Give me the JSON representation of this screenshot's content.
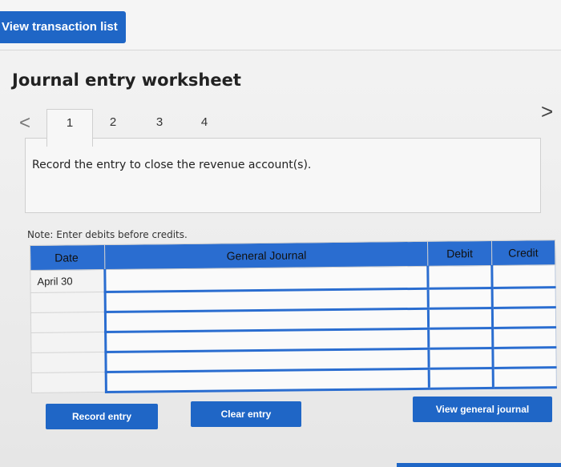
{
  "top": {
    "view_transaction_list": "View transaction list"
  },
  "worksheet": {
    "title": "Journal entry worksheet",
    "nav_prev": "<",
    "nav_next": ">",
    "tabs": [
      "1",
      "2",
      "3",
      "4"
    ],
    "active_tab": "1",
    "instruction": "Record the entry to close the revenue account(s).",
    "note": "Note: Enter debits before credits."
  },
  "journal": {
    "headers": {
      "date": "Date",
      "general_journal": "General Journal",
      "debit": "Debit",
      "credit": "Credit"
    },
    "rows": [
      {
        "date": "April 30",
        "account": "",
        "debit": "",
        "credit": ""
      },
      {
        "date": "",
        "account": "",
        "debit": "",
        "credit": ""
      },
      {
        "date": "",
        "account": "",
        "debit": "",
        "credit": ""
      },
      {
        "date": "",
        "account": "",
        "debit": "",
        "credit": ""
      },
      {
        "date": "",
        "account": "",
        "debit": "",
        "credit": ""
      },
      {
        "date": "",
        "account": "",
        "debit": "",
        "credit": ""
      }
    ]
  },
  "buttons": {
    "record_entry": "Record entry",
    "clear_entry": "Clear entry",
    "view_general_journal": "View general journal"
  },
  "colors": {
    "accent": "#1f66c6",
    "header": "#2a6dd0"
  }
}
